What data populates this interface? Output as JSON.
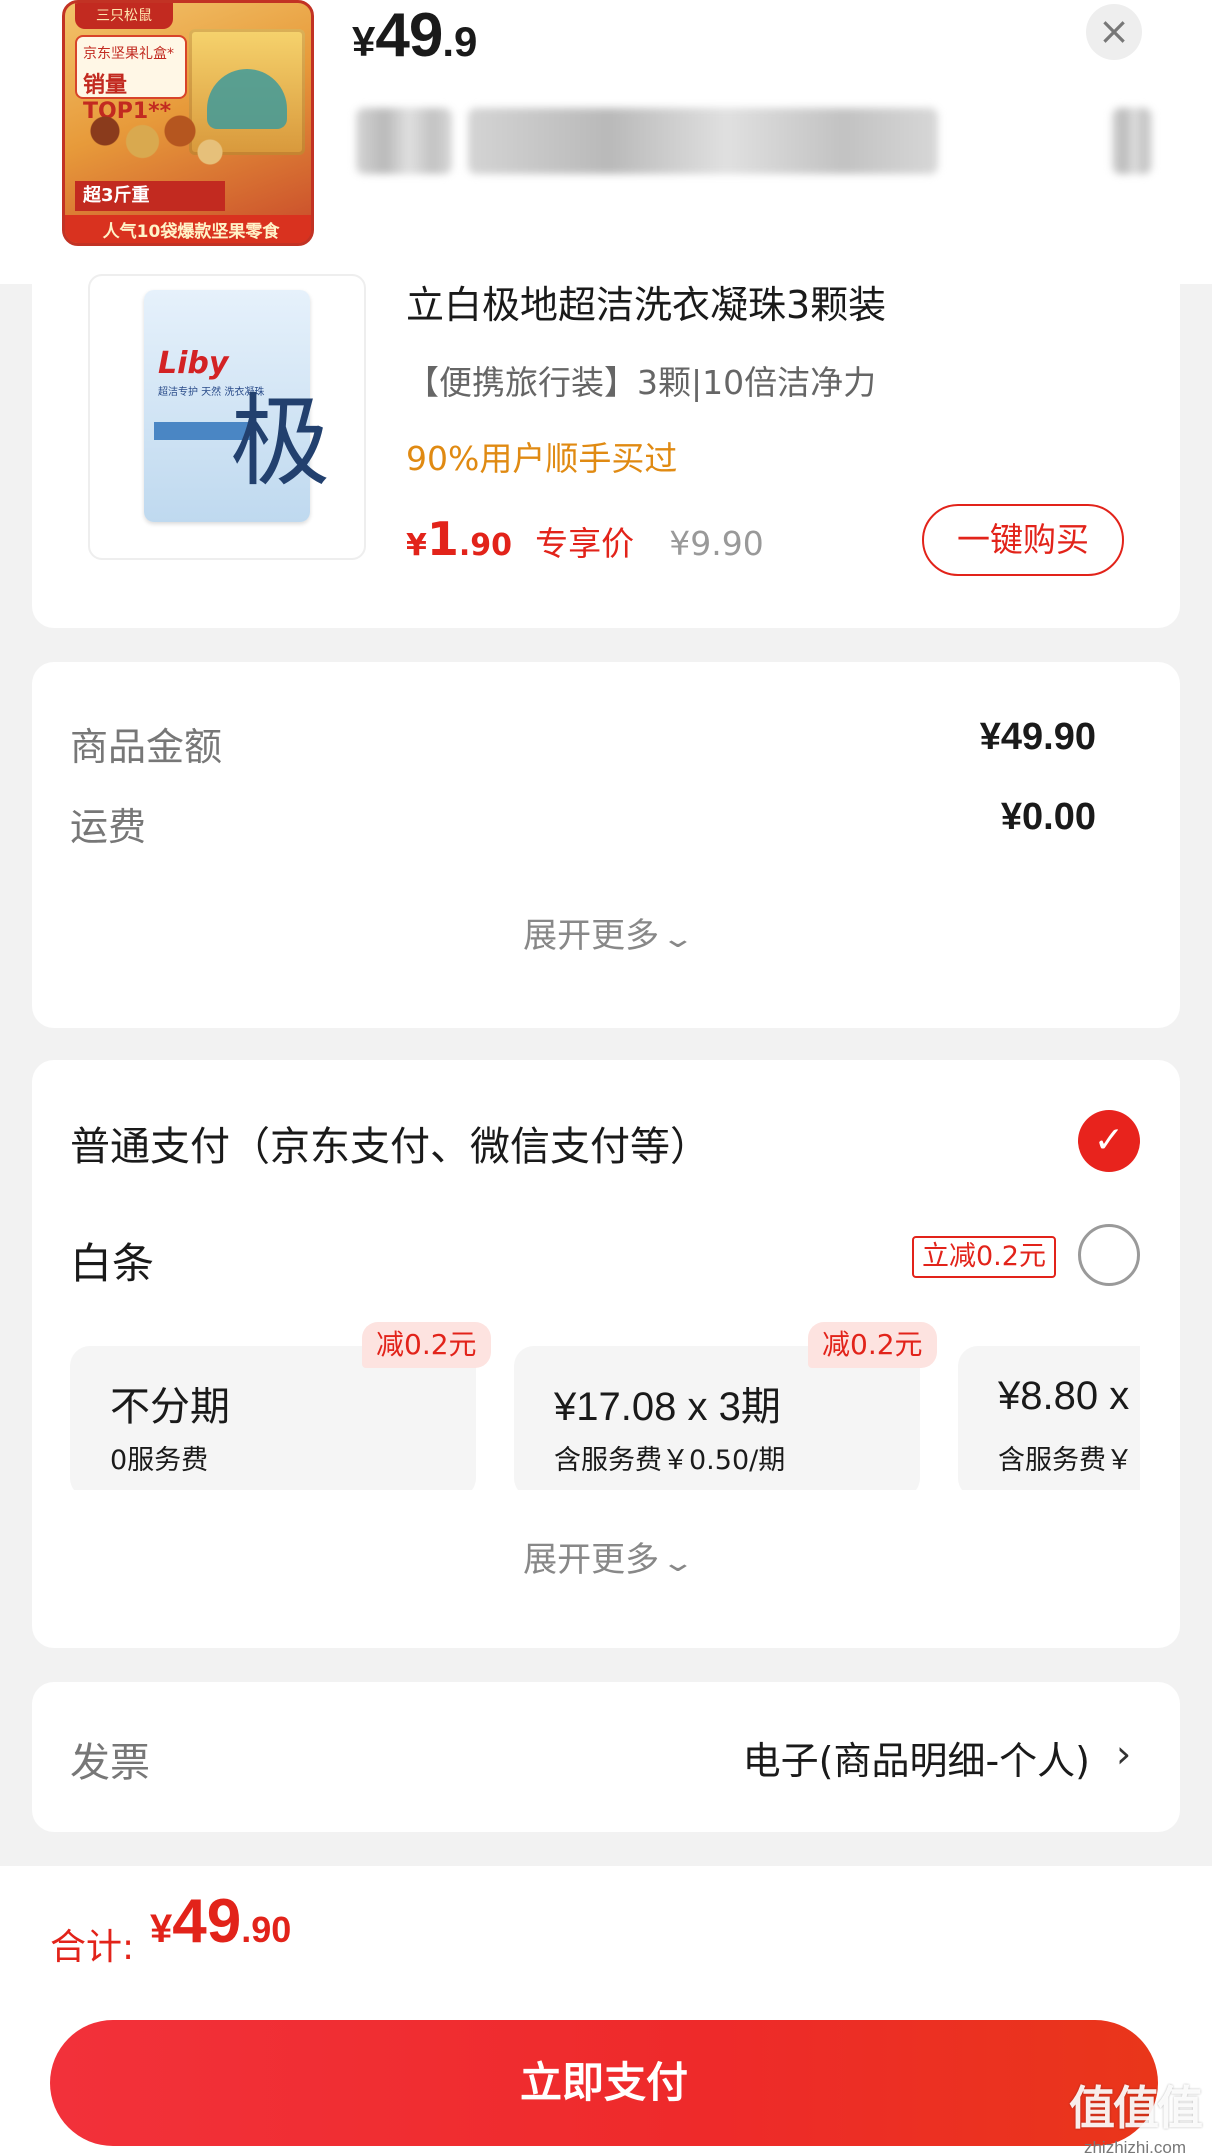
{
  "header": {
    "price_symbol": "¥",
    "price_int": "49",
    "price_dec": ".9",
    "close_icon": "close-icon",
    "thumbnail": {
      "brand": "三只松鼠",
      "tag_line1": "京东坚果礼盒*",
      "tag_line2": "销量TOP1**",
      "weight": "超3斤重",
      "bottom": "人气10袋爆款坚果零食"
    }
  },
  "addon": {
    "image_logo": "Liby",
    "image_text": "超洁专护 天然 洗衣凝珠",
    "image_big_char": "极",
    "title": "立白极地超洁洗衣凝珠3颗装",
    "subtitle": "【便携旅行装】3颗|10倍洁净力",
    "bought": "90%用户顺手买过",
    "price_symbol": "¥",
    "price_int": "1",
    "price_dec": ".90",
    "price_tag": "专享价",
    "original_price": "¥9.90",
    "buy_label": "一键购买"
  },
  "amounts": {
    "goods_label": "商品金额",
    "goods_value": "¥49.90",
    "shipping_label": "运费",
    "shipping_value": "¥0.00",
    "expand_label": "展开更多"
  },
  "payment": {
    "normal_label": "普通支付（京东支付、微信支付等）",
    "normal_selected": true,
    "baitiao_label": "白条",
    "baitiao_discount": "立减0.2元",
    "plans": [
      {
        "line1": "不分期",
        "line2": "0服务费",
        "badge": "减0.2元"
      },
      {
        "line1": "¥17.08 x 3期",
        "line2": "含服务费￥0.50/期",
        "badge": "减0.2元"
      },
      {
        "line1": "¥8.80 x",
        "line2": "含服务费￥",
        "badge": ""
      }
    ],
    "expand_label": "展开更多"
  },
  "invoice": {
    "label": "发票",
    "value": "电子(商品明细-个人)"
  },
  "total": {
    "label": "合计:",
    "symbol": "¥",
    "int": "49",
    "dec": ".90"
  },
  "pay_button": "立即支付",
  "watermark": {
    "big": "值值值",
    "small": "zhizhizhi.com"
  },
  "colors": {
    "accent_red": "#e2231a",
    "orange": "#e08a12",
    "background": "#f2f2f2"
  }
}
